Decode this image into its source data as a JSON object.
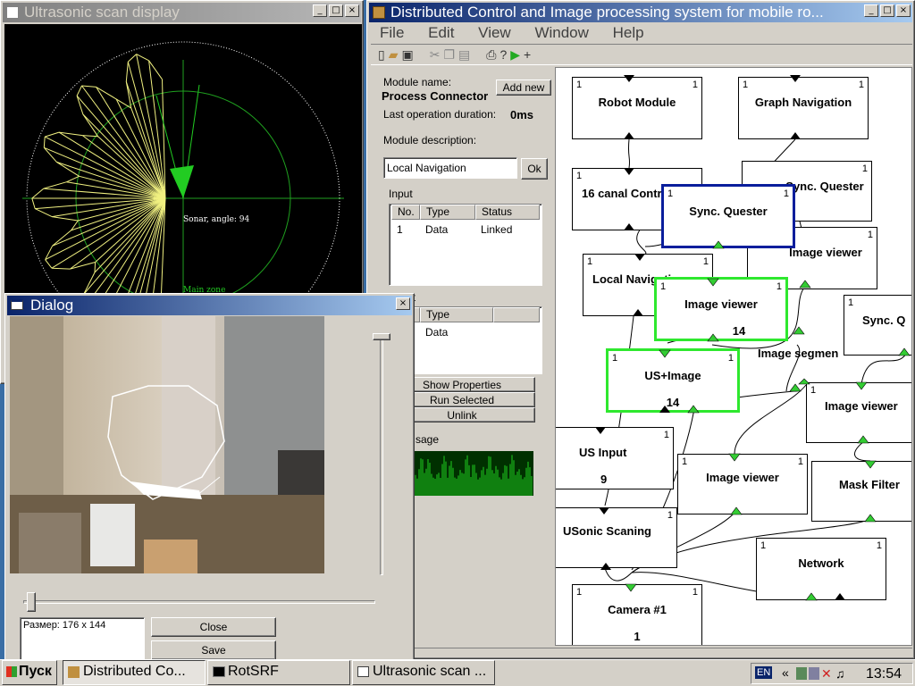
{
  "ultrasonic": {
    "title": "Ultrasonic scan display",
    "sonar_label": "Sonar, angle: 94",
    "zone_label": "Main zone"
  },
  "main_window": {
    "title": "Distributed Control and Image processing system for mobile ro...",
    "menu": [
      "File",
      "Edit",
      "View",
      "Window",
      "Help"
    ],
    "panel": {
      "module_name_label": "Module name:",
      "module_name_value": "Process Connector",
      "add_new": "Add new",
      "last_op_label": "Last operation duration:",
      "last_op_value": "0ms",
      "description_label": "Module description:",
      "description_value": "Local Navigation",
      "ok": "Ok",
      "input_label": "Input",
      "input_headers": [
        "No.",
        "Type",
        "Status"
      ],
      "input_row": [
        "1",
        "Data",
        "Linked"
      ],
      "output_label_fragment": "ut",
      "output_header": "Type",
      "output_row": "Data",
      "show_properties": "Show Properties",
      "run_selected": "Run Selected",
      "unlink": "Unlink",
      "usage_fragment": "sage"
    },
    "nodes": {
      "robot_module": "Robot Module",
      "graph_navigation": "Graph Navigation",
      "canal_control": "16 canal Contr",
      "sync_quester_back": "Sync. Quester",
      "sync_quester": "Sync. Quester",
      "image_viewer_a": "Image viewer",
      "local_navigation": "Local Navigation",
      "image_viewer_b": "Image viewer",
      "image_viewer_b_num": "14",
      "sync_q_right": "Sync. Q",
      "image_segment": "Image segmen",
      "us_image": "US+Image",
      "us_image_num": "14",
      "image_viewer_c": "Image viewer",
      "us_input": "US Input",
      "us_input_num": "9",
      "image_viewer_d": "Image viewer",
      "mask_filter": "Mask Filter",
      "usonic_scaning": "USonic Scaning",
      "network": "Network",
      "camera": "Camera #1",
      "camera_num": "1",
      "one": "1"
    }
  },
  "dialog": {
    "title": "Dialog",
    "size_text": "Размер: 176 x 144",
    "close": "Close",
    "save": "Save"
  },
  "taskbar": {
    "start": "Пуск",
    "items": [
      "Distributed Co...",
      "RotSRF",
      "Ultrasonic scan ..."
    ],
    "lang": "EN",
    "clock": "13:54"
  },
  "colors": {
    "desktop": "#3a6ea5",
    "selected_blue": "#0a1e9c",
    "selected_green": "#2ee82e",
    "port_green": "#33cc33"
  }
}
